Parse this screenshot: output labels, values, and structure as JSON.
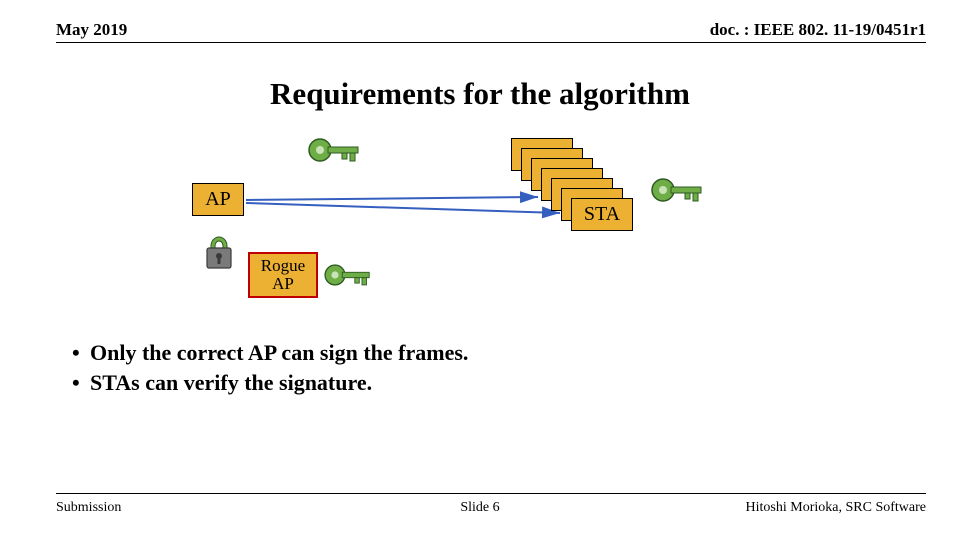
{
  "header": {
    "left": "May 2019",
    "right": "doc. : IEEE 802. 11-19/0451r1"
  },
  "title": "Requirements for the algorithm",
  "diagram": {
    "ap_label": "AP",
    "rogue_label": "Rogue AP",
    "sta_label": "STA"
  },
  "bullets": [
    "Only the correct AP can sign the frames.",
    "STAs can verify the signature."
  ],
  "footer": {
    "left": "Submission",
    "center": "Slide 6",
    "right": "Hitoshi Morioka, SRC Software"
  }
}
